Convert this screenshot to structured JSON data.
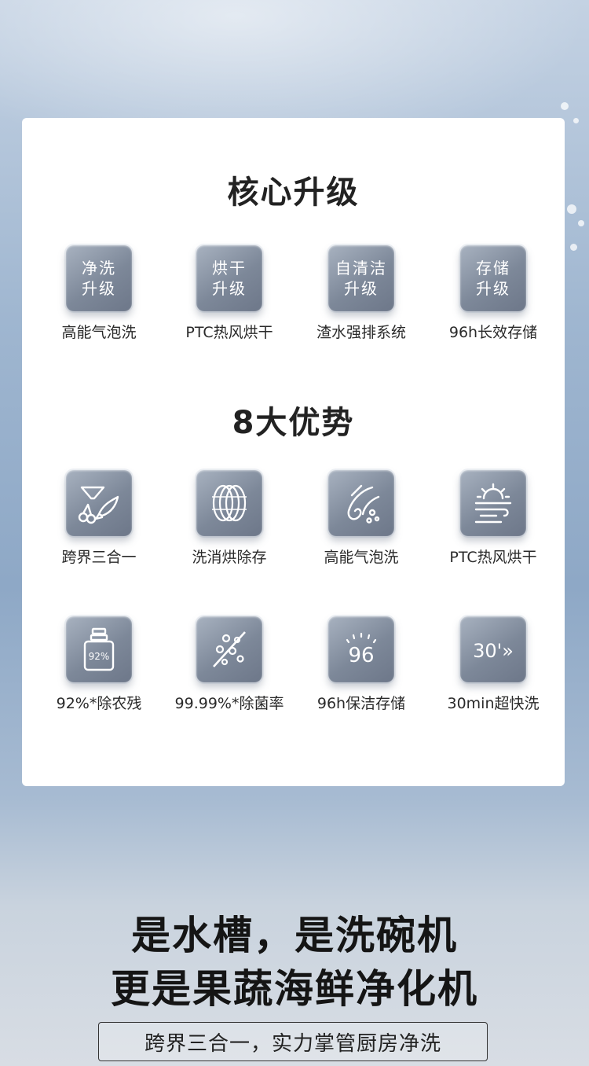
{
  "core_upgrades": {
    "title": "核心升级",
    "items": [
      {
        "badge": "净洗\n升级",
        "label": "高能气泡洗"
      },
      {
        "badge": "烘干\n升级",
        "label": "PTC热风烘干"
      },
      {
        "badge": "自清洁\n升级",
        "label": "渣水强排系统"
      },
      {
        "badge": "存储\n升级",
        "label": "96h长效存储"
      }
    ]
  },
  "advantages": {
    "title": "8大优势",
    "row1": [
      {
        "icon": "fish-cherry-icon",
        "label": "跨界三合一"
      },
      {
        "icon": "rings-icon",
        "label": "洗消烘除存"
      },
      {
        "icon": "bubble-wash-icon",
        "label": "高能气泡洗"
      },
      {
        "icon": "sun-wind-icon",
        "label": "PTC热风烘干"
      }
    ],
    "row2": [
      {
        "icon": "pesticide-bottle-icon",
        "icon_text": "92%",
        "label": "92%*除农残"
      },
      {
        "icon": "no-bacteria-icon",
        "label": "99.99%*除菌率"
      },
      {
        "icon": "storage-96-icon",
        "icon_text": "96",
        "label": "96h保洁存储"
      },
      {
        "icon": "timer-30-icon",
        "icon_text": "30'»",
        "label": "30min超快洗"
      }
    ]
  },
  "headline": {
    "line1": "是水槽，是洗碗机",
    "line2": "更是果蔬海鲜净化机"
  },
  "tagline": "跨界三合一，实力掌管厨房净洗",
  "colors": {
    "tile_gradient_start": "#a8b2c0",
    "tile_gradient_end": "#6d7789",
    "card": "#ffffff",
    "heading": "#222222"
  }
}
